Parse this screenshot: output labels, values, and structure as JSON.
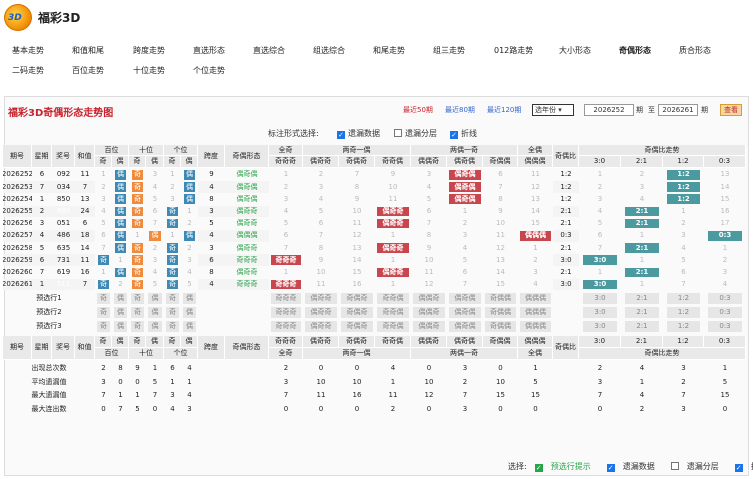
{
  "app": {
    "title": "福彩3D",
    "logo_text": "3D"
  },
  "nav": {
    "row1": [
      "基本走势",
      "和值和尾",
      "跨度走势",
      "直选形态",
      "直选综合",
      "组选综合",
      "和尾走势",
      "组三走势",
      "012路走势",
      "大小形态",
      "奇偶形态",
      "质合形态"
    ],
    "row2": [
      "二码走势",
      "百位走势",
      "十位走势",
      "个位走势"
    ]
  },
  "panel": {
    "title": "福彩3D奇偶形态走势图",
    "recent": [
      "最近50期",
      "最近80期",
      "最近120期"
    ],
    "period_select": "选年份",
    "from_value": "2026252",
    "period_label": "期",
    "to_label": "至",
    "to_value": "2026261",
    "period_label2": "期",
    "query": "查看"
  },
  "options": {
    "label": "标注形式选择:",
    "items": [
      {
        "label": "遗漏数据",
        "checked": true
      },
      {
        "label": "遗漏分层",
        "checked": false
      },
      {
        "label": "折线",
        "checked": true
      }
    ]
  },
  "headers": {
    "issue": "期号",
    "week": "星期",
    "prize": "奖号",
    "sum": "和值",
    "bai": "百位",
    "shi": "十位",
    "ge": "个位",
    "odd": "奇",
    "even": "偶",
    "span": "跨度",
    "form": "奇偶形态",
    "all_odd": "全奇",
    "g1": "两奇一偶",
    "g2": "两偶一奇",
    "all_even": "全偶",
    "ratio": "奇偶比",
    "ratio_trend": "奇偶比走势",
    "sub1": [
      "奇奇奇"
    ],
    "sub2": [
      "偶奇奇",
      "奇偶奇",
      "奇奇偶"
    ],
    "sub3": [
      "偶偶奇",
      "偶奇偶",
      "奇偶偶"
    ],
    "sub4": [
      "偶偶偶"
    ],
    "ratios": [
      "3:0",
      "2:1",
      "1:2",
      "0:3"
    ]
  },
  "rows": [
    {
      "issue": "2026252",
      "week": "6",
      "prize": "092",
      "sum": "11",
      "form": "偶奇偶",
      "ratio": "1:2",
      "bai": [
        "1",
        "偶"
      ],
      "shi": [
        "奇",
        "3"
      ],
      "ge": [
        "1",
        "偶"
      ],
      "span": "9",
      "grp": [
        "1",
        "2",
        "7",
        "9",
        "3",
        "偶奇偶",
        "6",
        "11"
      ],
      "rt": [
        "1",
        "2",
        "1:2",
        "13"
      ]
    },
    {
      "issue": "2026253",
      "week": "7",
      "prize": "034",
      "sum": "7",
      "form": "偶奇偶",
      "ratio": "1:2",
      "bai": [
        "2",
        "偶"
      ],
      "shi": [
        "奇",
        "4"
      ],
      "ge": [
        "2",
        "偶"
      ],
      "span": "4",
      "grp": [
        "2",
        "3",
        "8",
        "10",
        "4",
        "偶奇偶",
        "7",
        "12"
      ],
      "rt": [
        "2",
        "3",
        "1:2",
        "14"
      ]
    },
    {
      "issue": "2026254",
      "week": "1",
      "prize": "850",
      "sum": "13",
      "form": "偶奇偶",
      "ratio": "1:2",
      "bai": [
        "3",
        "偶"
      ],
      "shi": [
        "奇",
        "5"
      ],
      "ge": [
        "3",
        "偶"
      ],
      "span": "8",
      "grp": [
        "3",
        "4",
        "9",
        "11",
        "5",
        "偶奇偶",
        "8",
        "13"
      ],
      "rt": [
        "3",
        "4",
        "1:2",
        "15"
      ]
    },
    {
      "issue": "2026255",
      "week": "2",
      "prize": "699",
      "sum": "24",
      "form": "偶奇奇",
      "ratio": "2:1",
      "bai": [
        "4",
        "偶"
      ],
      "shi": [
        "奇",
        "6"
      ],
      "ge": [
        "奇",
        "1"
      ],
      "span": "3",
      "grp": [
        "4",
        "5",
        "10",
        "偶奇奇",
        "6",
        "1",
        "9",
        "14"
      ],
      "rt": [
        "4",
        "2:1",
        "1",
        "16"
      ]
    },
    {
      "issue": "2026256",
      "week": "3",
      "prize": "051",
      "sum": "6",
      "form": "偶奇奇",
      "ratio": "2:1",
      "bai": [
        "5",
        "偶"
      ],
      "shi": [
        "奇",
        "7"
      ],
      "ge": [
        "奇",
        "2"
      ],
      "span": "5",
      "grp": [
        "5",
        "6",
        "11",
        "偶奇奇",
        "7",
        "2",
        "10",
        "15"
      ],
      "rt": [
        "5",
        "2:1",
        "2",
        "17"
      ]
    },
    {
      "issue": "2026257",
      "week": "4",
      "prize": "486",
      "sum": "18",
      "form": "偶偶偶",
      "ratio": "0:3",
      "bai": [
        "6",
        "偶"
      ],
      "shi": [
        "1",
        "偶"
      ],
      "ge": [
        "1",
        "偶"
      ],
      "span": "4",
      "grp": [
        "6",
        "7",
        "12",
        "1",
        "8",
        "3",
        "11",
        "偶偶偶"
      ],
      "rt": [
        "6",
        "1",
        "3",
        "0:3"
      ]
    },
    {
      "issue": "2026258",
      "week": "5",
      "prize": "635",
      "sum": "14",
      "form": "偶奇奇",
      "ratio": "2:1",
      "bai": [
        "7",
        "偶"
      ],
      "shi": [
        "奇",
        "2"
      ],
      "ge": [
        "奇",
        "2"
      ],
      "span": "3",
      "grp": [
        "7",
        "8",
        "13",
        "偶奇奇",
        "9",
        "4",
        "12",
        "1"
      ],
      "rt": [
        "7",
        "2:1",
        "4",
        "1"
      ]
    },
    {
      "issue": "2026259",
      "week": "6",
      "prize": "731",
      "sum": "11",
      "form": "奇奇奇",
      "ratio": "3:0",
      "bai": [
        "奇",
        "1"
      ],
      "shi": [
        "奇",
        "3"
      ],
      "ge": [
        "奇",
        "3"
      ],
      "span": "6",
      "grp": [
        "奇奇奇",
        "9",
        "14",
        "1",
        "10",
        "5",
        "13",
        "2"
      ],
      "rt": [
        "3:0",
        "1",
        "5",
        "2"
      ]
    },
    {
      "issue": "2026260",
      "week": "7",
      "prize": "619",
      "sum": "16",
      "form": "偶奇奇",
      "ratio": "2:1",
      "bai": [
        "1",
        "偶"
      ],
      "shi": [
        "奇",
        "4"
      ],
      "ge": [
        "奇",
        "4"
      ],
      "span": "8",
      "grp": [
        "1",
        "10",
        "15",
        "偶奇奇",
        "11",
        "6",
        "14",
        "3"
      ],
      "rt": [
        "1",
        "2:1",
        "6",
        "3"
      ]
    },
    {
      "issue": "2026261",
      "week": "1",
      "prize": "511",
      "sum": "7",
      "form": "奇奇奇",
      "ratio": "3:0",
      "bai": [
        "奇",
        "2"
      ],
      "shi": [
        "奇",
        "5"
      ],
      "ge": [
        "奇",
        "5"
      ],
      "span": "4",
      "grp": [
        "奇奇奇",
        "11",
        "16",
        "1",
        "12",
        "7",
        "15",
        "4"
      ],
      "rt": [
        "3:0",
        "1",
        "7",
        "4"
      ]
    }
  ],
  "predict": {
    "labels": [
      "预选行1",
      "预选行2",
      "预选行3"
    ],
    "cells": [
      "奇",
      "偶",
      "奇",
      "偶",
      "奇",
      "偶"
    ],
    "grp": [
      "奇奇奇",
      "偶奇奇",
      "奇偶奇",
      "奇奇偶",
      "偶偶奇",
      "偶奇偶",
      "奇偶偶",
      "偶偶偶"
    ],
    "rt": [
      "3:0",
      "2:1",
      "1:2",
      "0:3"
    ]
  },
  "stats": {
    "labels": [
      "出现总次数",
      "平均遗漏值",
      "最大遗漏值",
      "最大连出数"
    ],
    "values": [
      [
        "2",
        "8",
        "9",
        "1",
        "6",
        "4",
        "",
        "",
        "2",
        "0",
        "0",
        "4",
        "0",
        "3",
        "0",
        "1",
        "2",
        "4",
        "3",
        "1"
      ],
      [
        "3",
        "0",
        "0",
        "5",
        "1",
        "1",
        "",
        "",
        "3",
        "10",
        "10",
        "1",
        "10",
        "2",
        "10",
        "5",
        "3",
        "1",
        "2",
        "5"
      ],
      [
        "7",
        "1",
        "1",
        "7",
        "3",
        "4",
        "",
        "",
        "7",
        "11",
        "16",
        "11",
        "12",
        "7",
        "15",
        "15",
        "7",
        "4",
        "7",
        "15"
      ],
      [
        "0",
        "7",
        "5",
        "0",
        "4",
        "3",
        "",
        "",
        "0",
        "0",
        "0",
        "2",
        "0",
        "3",
        "0",
        "0",
        "0",
        "2",
        "3",
        "0"
      ]
    ]
  },
  "footer": {
    "label": "选择:",
    "items": [
      {
        "label": "预选行提示",
        "checked": true,
        "green": true
      },
      {
        "label": "遗漏数据",
        "checked": true
      },
      {
        "label": "遗漏分层",
        "checked": false
      },
      {
        "label": "折线",
        "checked": true
      }
    ]
  },
  "colors": {
    "accent": "#c8232c",
    "blue": "#3e8ab5",
    "orange": "#f08a3c",
    "teal": "#4a9aa0"
  }
}
